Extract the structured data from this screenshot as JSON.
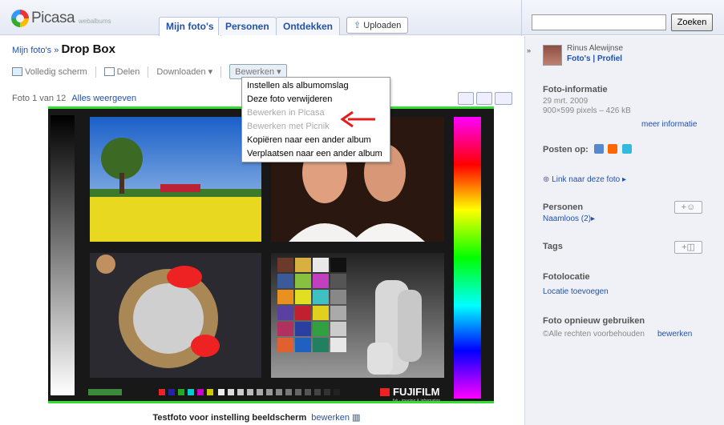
{
  "header": {
    "brand": "Picasa",
    "brand_sub": "webalbums",
    "tabs": [
      "Mijn foto's",
      "Personen",
      "Ontdekken"
    ],
    "upload_label": "Uploaden",
    "search_placeholder": "",
    "search_button": "Zoeken"
  },
  "breadcrumb": {
    "parent": "Mijn foto's",
    "separator": "»",
    "album": "Drop Box"
  },
  "toolbar": {
    "fullscreen": "Volledig scherm",
    "share": "Delen",
    "download": "Downloaden",
    "edit": "Bewerken"
  },
  "dropdown": {
    "items": [
      {
        "label": "Instellen als albumomslag",
        "enabled": true
      },
      {
        "label": "Deze foto verwijderen",
        "enabled": true
      },
      {
        "label": "Bewerken in Picasa",
        "enabled": false
      },
      {
        "label": "Bewerken met Picnik",
        "enabled": false
      },
      {
        "label": "Kopiëren naar een ander album",
        "enabled": true
      },
      {
        "label": "Verplaatsen naar een ander album",
        "enabled": true
      }
    ]
  },
  "photo_nav": {
    "counter": "Foto 1 van 12",
    "view_all": "Alles weergeven"
  },
  "caption": {
    "text": "Testfoto voor instelling beeldscherm",
    "edit": "bewerken"
  },
  "photo": {
    "brand": "FUJIFILM",
    "brand_tagline": "fuji - imaging & information"
  },
  "sidebar": {
    "user_name": "Rinus Alewijnse",
    "user_links": "Foto's | Profiel",
    "info_title": "Foto-informatie",
    "date": "29 mrt. 2009",
    "size": "900×599 pixels – 426 kB",
    "more_info": "meer informatie",
    "post_on": "Posten op:",
    "link_photo": "Link naar deze foto ▸",
    "people_title": "Personen",
    "people_value": "Naamloos (2)▸",
    "tags_title": "Tags",
    "location_title": "Fotolocatie",
    "location_add": "Locatie toevoegen",
    "reuse_title": "Foto opnieuw gebruiken",
    "rights": "Alle rechten voorbehouden",
    "rights_edit": "bewerken"
  },
  "colors": {
    "link": "#2251a8",
    "accent_green": "#33dd33",
    "arrow_red": "#e31c1c"
  }
}
